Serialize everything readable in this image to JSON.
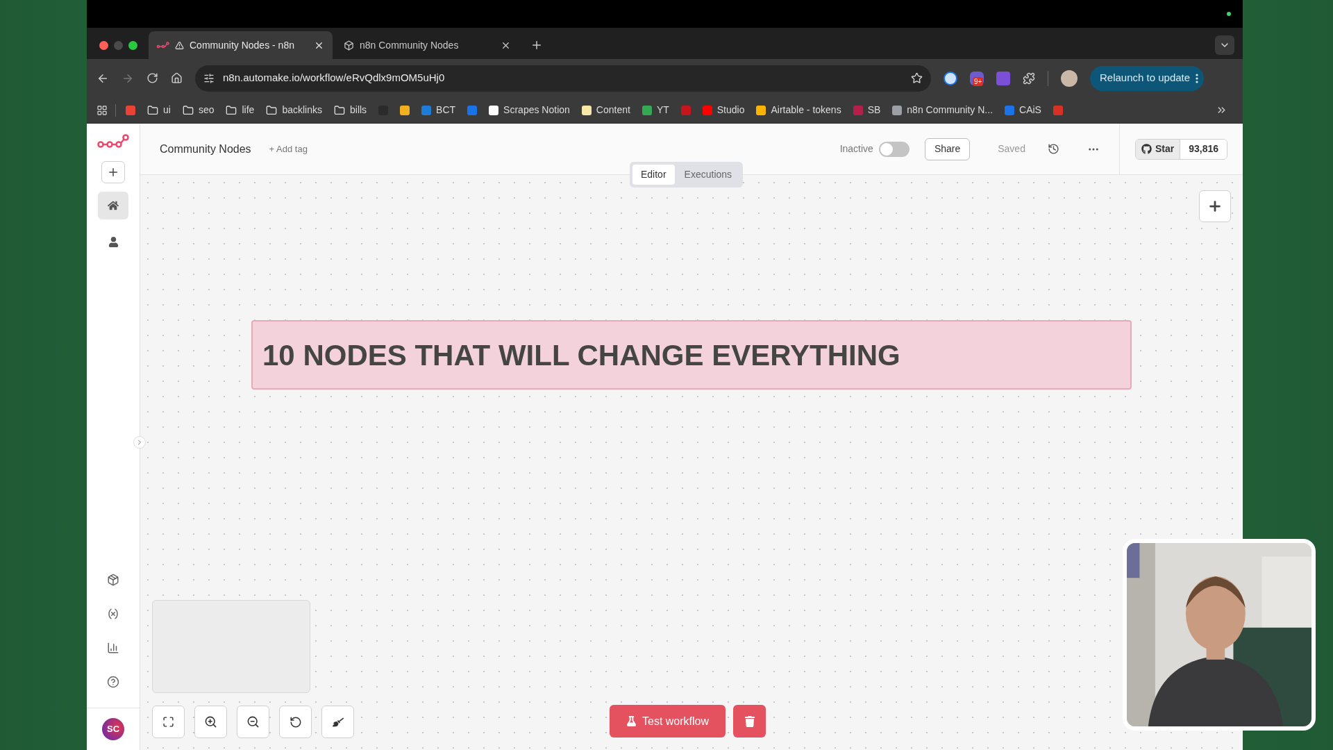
{
  "browser": {
    "tabs": [
      {
        "title": "Community Nodes - n8n",
        "selected": true,
        "warning": true
      },
      {
        "title": "n8n Community Nodes",
        "selected": false,
        "warning": false
      }
    ],
    "address": "n8n.automake.io/workflow/eRvQdlx9mOM5uHj0",
    "extension_badge": "9+",
    "relaunch": "Relaunch to update",
    "bookmarks": [
      {
        "kind": "site",
        "color": "#ea4335"
      },
      {
        "kind": "folder",
        "label": "ui"
      },
      {
        "kind": "folder",
        "label": "seo"
      },
      {
        "kind": "folder",
        "label": "life"
      },
      {
        "kind": "folder",
        "label": "backlinks"
      },
      {
        "kind": "folder",
        "label": "bills"
      },
      {
        "kind": "site",
        "color": "#2b2b2b"
      },
      {
        "kind": "site",
        "color": "#f2b01e"
      },
      {
        "kind": "site",
        "color": "#1e7bd6",
        "label": "BCT"
      },
      {
        "kind": "site",
        "color": "#1a73e8"
      },
      {
        "kind": "site",
        "color": "#ffffff",
        "label": "Scrapes Notion"
      },
      {
        "kind": "site",
        "color": "#f6e7a8",
        "label": "Content"
      },
      {
        "kind": "site",
        "color": "#34a853",
        "label": "YT"
      },
      {
        "kind": "site",
        "color": "#c4161c"
      },
      {
        "kind": "site",
        "color": "#ff0000",
        "label": "Studio"
      },
      {
        "kind": "site",
        "color": "#fcb400",
        "label": "Airtable - tokens"
      },
      {
        "kind": "site",
        "color": "#b3204a",
        "label": "SB"
      },
      {
        "kind": "site",
        "color": "#9aa0a6",
        "label": "n8n Community N..."
      },
      {
        "kind": "site",
        "color": "#1a73e8",
        "label": "CAiS"
      },
      {
        "kind": "site",
        "color": "#d93025"
      }
    ]
  },
  "app": {
    "sidebar": [
      {
        "kind": "home",
        "selected": true
      },
      {
        "kind": "user",
        "selected": false
      }
    ],
    "avatar": "SC",
    "workflow_name": "Community Nodes",
    "add_tag": "+ Add tag",
    "status": "Inactive",
    "active": false,
    "share": "Share",
    "saved": "Saved",
    "star": "Star",
    "star_count": "93,816",
    "views": [
      {
        "label": "Editor",
        "selected": true
      },
      {
        "label": "Executions",
        "selected": false
      }
    ],
    "sticky_note": "10 NODES THAT WILL CHANGE EVERYTHING",
    "test_button": "Test workflow"
  }
}
